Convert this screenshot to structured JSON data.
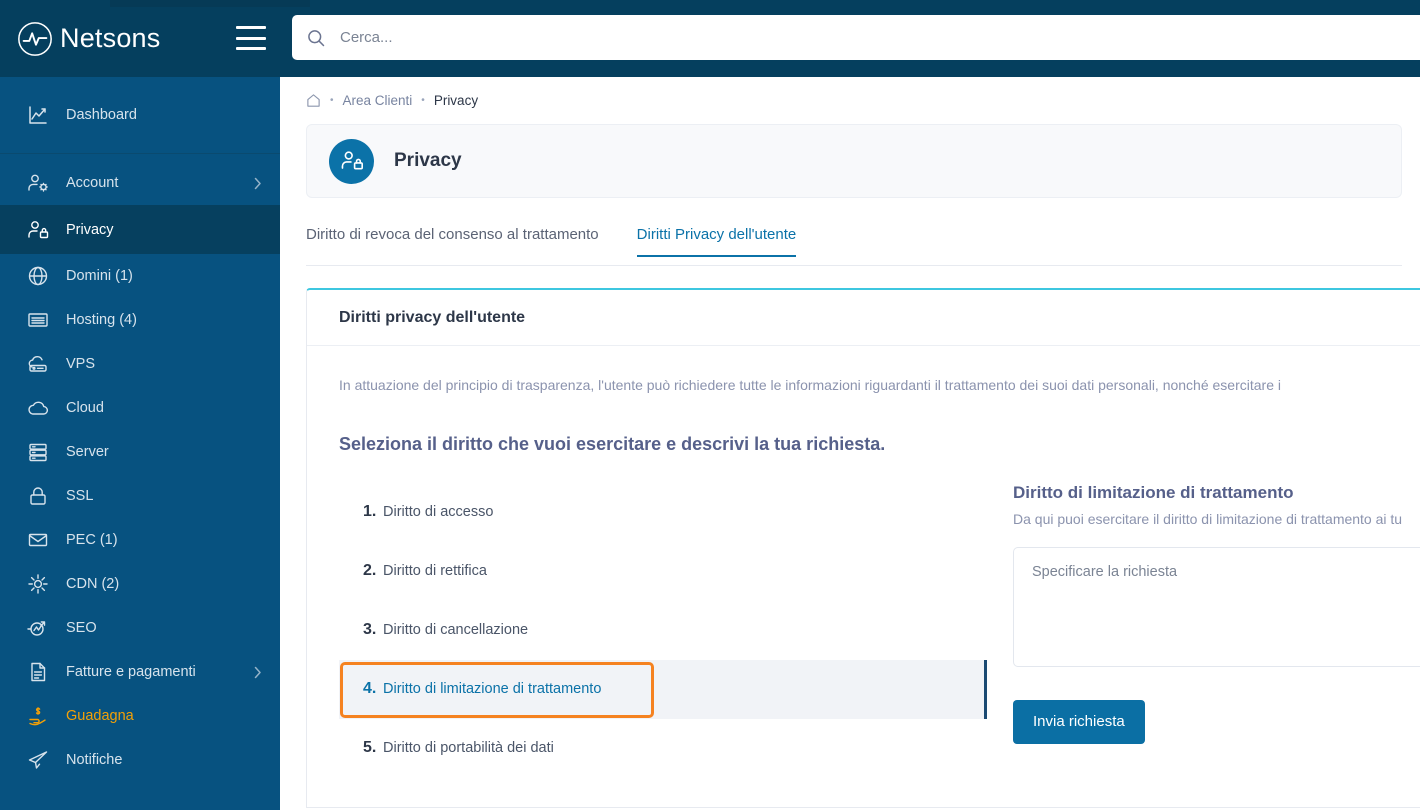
{
  "brand": {
    "name": "Netsons",
    "logo_icon": "netsons-logo-icon",
    "menu_icon": "hamburger-menu-icon"
  },
  "search": {
    "placeholder": "Cerca...",
    "value": "",
    "icon": "search-icon"
  },
  "breadcrumb": {
    "home_icon": "home-icon",
    "separator": "•",
    "items": [
      {
        "label": "Area Clienti",
        "current": false
      },
      {
        "label": "Privacy",
        "current": true
      }
    ]
  },
  "sidebar": {
    "items": [
      {
        "label": "Dashboard",
        "icon": "dashboard-chart-icon",
        "state": "default",
        "chevron": false
      },
      {
        "label": "Account",
        "icon": "account-gear-icon",
        "state": "default",
        "chevron": true
      },
      {
        "label": "Privacy",
        "icon": "privacy-lock-user-icon",
        "state": "active",
        "chevron": false
      },
      {
        "label": "Domini (1)",
        "icon": "globe-icon",
        "state": "default",
        "chevron": false
      },
      {
        "label": "Hosting (4)",
        "icon": "server-lines-icon",
        "state": "default",
        "chevron": false
      },
      {
        "label": "VPS",
        "icon": "vps-cloud-icon",
        "state": "default",
        "chevron": false
      },
      {
        "label": "Cloud",
        "icon": "cloud-icon",
        "state": "default",
        "chevron": false
      },
      {
        "label": "Server",
        "icon": "server-rack-icon",
        "state": "default",
        "chevron": false
      },
      {
        "label": "SSL",
        "icon": "padlock-icon",
        "state": "default",
        "chevron": false
      },
      {
        "label": "PEC (1)",
        "icon": "envelope-icon",
        "state": "default",
        "chevron": false
      },
      {
        "label": "CDN (2)",
        "icon": "cdn-burst-icon",
        "state": "default",
        "chevron": false
      },
      {
        "label": "SEO",
        "icon": "seo-arrow-icon",
        "state": "default",
        "chevron": false
      },
      {
        "label": "Fatture e pagamenti",
        "icon": "invoice-document-icon",
        "state": "default",
        "chevron": true
      },
      {
        "label": "Guadagna",
        "icon": "earn-hand-coin-icon",
        "state": "highlight",
        "chevron": false
      },
      {
        "label": "Notifiche",
        "icon": "paper-plane-icon",
        "state": "default",
        "chevron": false
      }
    ]
  },
  "page": {
    "title": "Privacy",
    "icon": "privacy-lock-user-icon",
    "tabs": [
      {
        "label": "Diritto di revoca del consenso al trattamento",
        "active": false
      },
      {
        "label": "Diritti Privacy dell'utente",
        "active": true
      }
    ]
  },
  "card": {
    "header": "Diritti privacy dell'utente",
    "intro": "In attuazione del principio di trasparenza, l'utente può richiedere tutte le informazioni riguardanti il trattamento dei suoi dati personali, nonché esercitare i",
    "lead": "Seleziona il diritto che vuoi esercitare e descrivi la tua richiesta.",
    "rights": [
      {
        "num": "1.",
        "label": "Diritto di accesso",
        "selected": false
      },
      {
        "num": "2.",
        "label": "Diritto di rettifica",
        "selected": false
      },
      {
        "num": "3.",
        "label": "Diritto di cancellazione",
        "selected": false
      },
      {
        "num": "4.",
        "label": "Diritto di limitazione di trattamento",
        "selected": true
      },
      {
        "num": "5.",
        "label": "Diritto di portabilità dei dati",
        "selected": false
      }
    ],
    "detail": {
      "title": "Diritto di limitazione di trattamento",
      "subtitle": "Da qui puoi esercitare il diritto di limitazione di trattamento ai tu",
      "textarea_placeholder": "Specificare la richiesta",
      "textarea_value": "",
      "submit_label": "Invia richiesta"
    }
  },
  "colors": {
    "topbar": "#053f5e",
    "sidebar": "#075280",
    "sidebar_active": "#06405f",
    "accent_blue": "#0b72a8",
    "accent_cyan": "#3ec7e0",
    "focus_orange": "#f58220",
    "earn_yellow": "#f2a007",
    "button_blue": "#0b6fa4"
  }
}
